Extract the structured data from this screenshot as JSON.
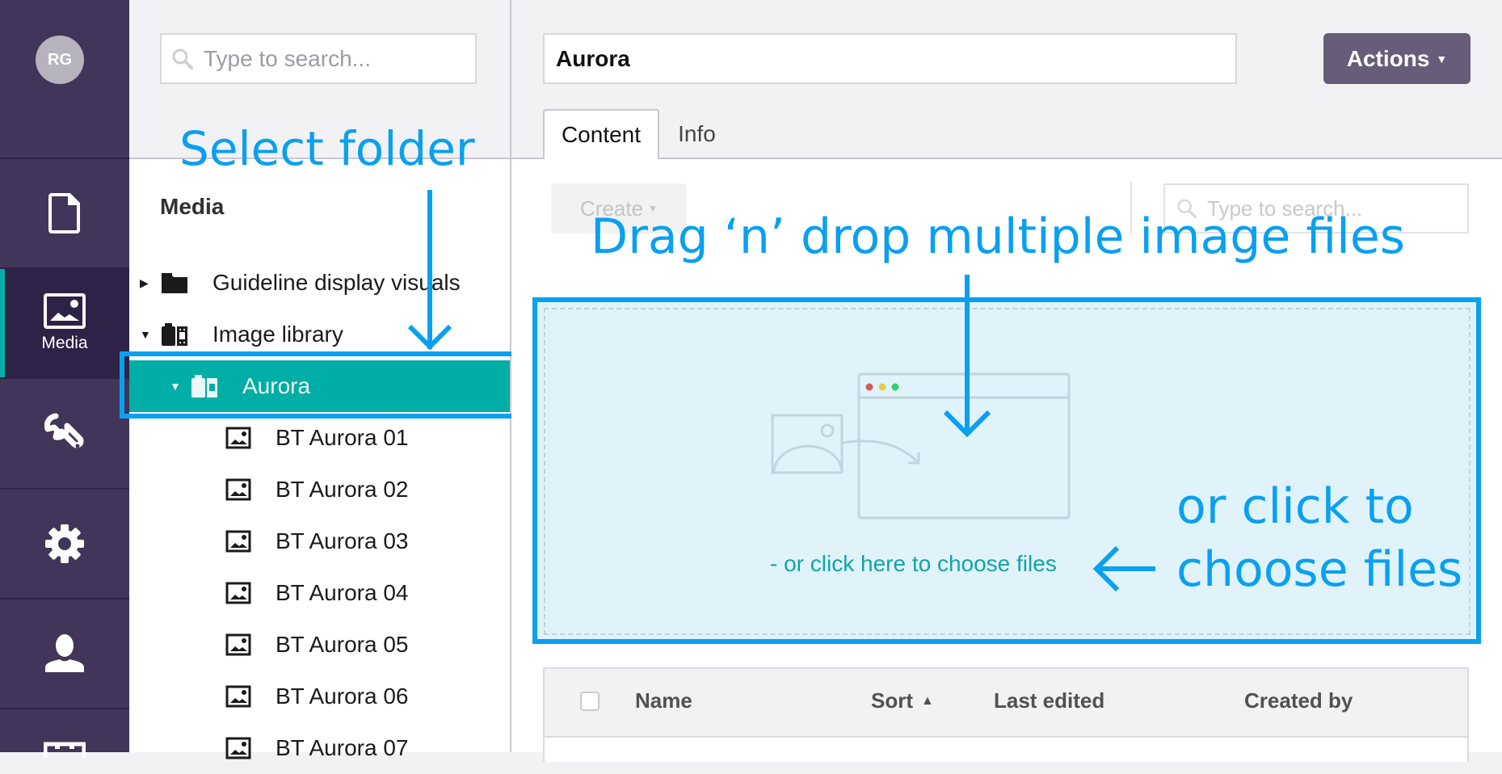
{
  "sidebar": {
    "avatar_initials": "RG",
    "items": [
      {
        "icon": "document-icon",
        "label": ""
      },
      {
        "icon": "image-icon",
        "label": "Media",
        "active": true
      },
      {
        "icon": "wrench-icon",
        "label": ""
      },
      {
        "icon": "gear-icon",
        "label": ""
      },
      {
        "icon": "user-icon",
        "label": ""
      },
      {
        "icon": "form-icon",
        "label": ""
      }
    ]
  },
  "tree": {
    "search_placeholder": "Type to search...",
    "section_title": "Media",
    "rows": [
      {
        "label": "Guideline display visuals",
        "icon": "folder-icon",
        "expanded": false
      },
      {
        "label": "Image library",
        "icon": "media-folder-icon",
        "expanded": true
      },
      {
        "label": "Aurora",
        "icon": "media-folder-icon",
        "expanded": true,
        "selected": true
      },
      {
        "label": "BT Aurora 01",
        "icon": "image-icon"
      },
      {
        "label": "BT Aurora 02",
        "icon": "image-icon"
      },
      {
        "label": "BT Aurora 03",
        "icon": "image-icon"
      },
      {
        "label": "BT Aurora 04",
        "icon": "image-icon"
      },
      {
        "label": "BT Aurora 05",
        "icon": "image-icon"
      },
      {
        "label": "BT Aurora 06",
        "icon": "image-icon"
      },
      {
        "label": "BT Aurora 07",
        "icon": "image-icon"
      }
    ]
  },
  "main": {
    "name_value": "Aurora",
    "actions_label": "Actions",
    "tabs": [
      {
        "label": "Content",
        "active": true
      },
      {
        "label": "Info",
        "active": false
      }
    ],
    "create_label": "Create",
    "list_search_placeholder": "Type to search...",
    "drop_link": "- or click here to choose files",
    "table_headers": [
      "Name",
      "Sort",
      "Last edited",
      "Created by"
    ]
  },
  "annotations": {
    "select_folder": "Select folder",
    "drag_drop": "Drag ‘n’ drop multiple image files",
    "click_line1": "or click to",
    "click_line2": "choose files"
  },
  "colors": {
    "nav_bg": "#413659",
    "nav_active": "#2e2246",
    "accent_teal": "#00aea5",
    "annotation_blue": "#0aa0f0",
    "actions_btn": "#675c7a",
    "dropzone_bg": "#e0f3fb"
  }
}
